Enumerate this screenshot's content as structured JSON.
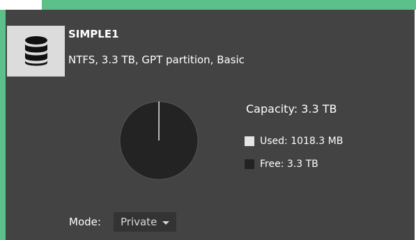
{
  "drive": {
    "name": "SIMPLE1",
    "details": "NTFS, 3.3 TB, GPT partition, Basic",
    "icon": "database-icon"
  },
  "usage": {
    "capacity_label": "Capacity: 3.3 TB",
    "used_label": "Used: 1018.3 MB",
    "free_label": "Free: 3.3 TB",
    "used_fraction": 0.0003
  },
  "mode": {
    "label": "Mode:",
    "selected": "Private"
  },
  "colors": {
    "accent": "#5cc08a",
    "panel": "#434343",
    "used": "#e6e6e6",
    "free": "#232323"
  }
}
